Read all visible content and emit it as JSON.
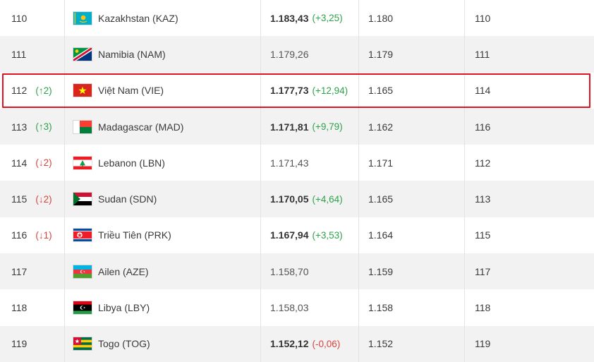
{
  "rows": [
    {
      "rank": "110",
      "move": "",
      "dir": "",
      "flag": "kaz",
      "country": "Kazakhstan (KAZ)",
      "points": "1.183,43",
      "bold": true,
      "delta": "(+3,25)",
      "deltaDir": "pos",
      "prev": "1.180",
      "prevRank": "110"
    },
    {
      "rank": "111",
      "move": "",
      "dir": "",
      "flag": "nam",
      "country": "Namibia (NAM)",
      "points": "1.179,26",
      "bold": false,
      "delta": "",
      "deltaDir": "",
      "prev": "1.179",
      "prevRank": "111"
    },
    {
      "rank": "112",
      "move": "(↑2)",
      "dir": "up",
      "flag": "vie",
      "country": "Việt Nam (VIE)",
      "points": "1.177,73",
      "bold": true,
      "delta": "(+12,94)",
      "deltaDir": "pos",
      "prev": "1.165",
      "prevRank": "114",
      "highlight": true
    },
    {
      "rank": "113",
      "move": "(↑3)",
      "dir": "up",
      "flag": "mad",
      "country": "Madagascar (MAD)",
      "points": "1.171,81",
      "bold": true,
      "delta": "(+9,79)",
      "deltaDir": "pos",
      "prev": "1.162",
      "prevRank": "116"
    },
    {
      "rank": "114",
      "move": "(↓2)",
      "dir": "down",
      "flag": "lbn",
      "country": "Lebanon (LBN)",
      "points": "1.171,43",
      "bold": false,
      "delta": "",
      "deltaDir": "",
      "prev": "1.171",
      "prevRank": "112"
    },
    {
      "rank": "115",
      "move": "(↓2)",
      "dir": "down",
      "flag": "sdn",
      "country": "Sudan (SDN)",
      "points": "1.170,05",
      "bold": true,
      "delta": "(+4,64)",
      "deltaDir": "pos",
      "prev": "1.165",
      "prevRank": "113"
    },
    {
      "rank": "116",
      "move": "(↓1)",
      "dir": "down",
      "flag": "prk",
      "country": "Triều Tiên (PRK)",
      "points": "1.167,94",
      "bold": true,
      "delta": "(+3,53)",
      "deltaDir": "pos",
      "prev": "1.164",
      "prevRank": "115"
    },
    {
      "rank": "117",
      "move": "",
      "dir": "",
      "flag": "aze",
      "country": "Ailen (AZE)",
      "points": "1.158,70",
      "bold": false,
      "delta": "",
      "deltaDir": "",
      "prev": "1.159",
      "prevRank": "117"
    },
    {
      "rank": "118",
      "move": "",
      "dir": "",
      "flag": "lby",
      "country": "Libya (LBY)",
      "points": "1.158,03",
      "bold": false,
      "delta": "",
      "deltaDir": "",
      "prev": "1.158",
      "prevRank": "118"
    },
    {
      "rank": "119",
      "move": "",
      "dir": "",
      "flag": "tog",
      "country": "Togo (TOG)",
      "points": "1.152,12",
      "bold": true,
      "delta": "(-0,06)",
      "deltaDir": "neg",
      "prev": "1.152",
      "prevRank": "119"
    }
  ],
  "colors": {
    "highlight_border": "#e0141e",
    "up": "#2ea24a",
    "down": "#d9443b",
    "alt_row": "#f2f2f2"
  }
}
